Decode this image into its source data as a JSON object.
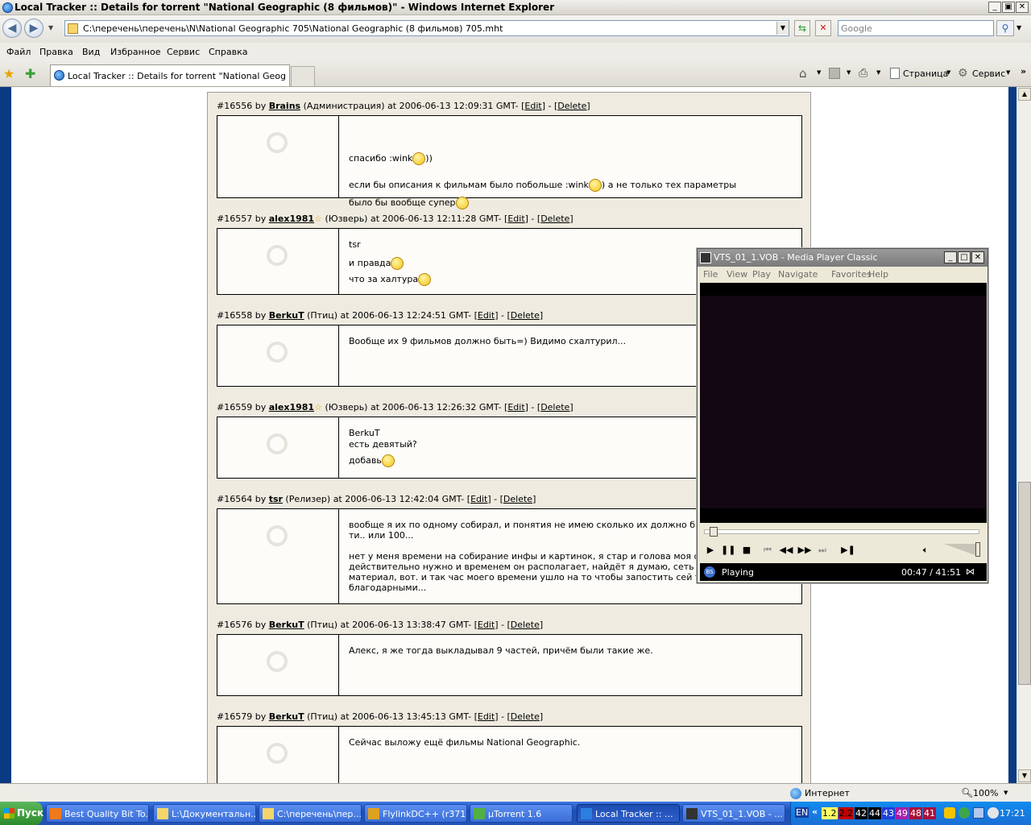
{
  "window": {
    "title": "Local Tracker :: Details for torrent \"National Geographic (8 фильмов)\" - Windows Internet Explorer"
  },
  "nav": {
    "address": "C:\\перечень\\перечень\\N\\National Geographic 705\\National Geographic (8 фильмов) 705.mht",
    "search_placeholder": "Google"
  },
  "menu": {
    "items": [
      "Файл",
      "Правка",
      "Вид",
      "Избранное",
      "Сервис",
      "Справка"
    ]
  },
  "tabs": {
    "active": "Local Tracker :: Details for torrent \"National Geograph...",
    "page_btn": "Страница",
    "tools_btn": "Сервис"
  },
  "posts": [
    {
      "head_pre": "#16556 by ",
      "user": "Brains",
      "head_post": " (Администрация) at 2006-06-13 12:09:31 GMT- [",
      "edit": "Edit",
      "sep": "] - [",
      "del": "Delete",
      "end": "]",
      "lines": [
        "спасибо :wink",
        "))",
        "если бы описания к фильмам было побольше :wink",
        ") а не только тех параметры",
        "было бы вообще супер"
      ]
    },
    {
      "head_pre": "#16557 by ",
      "user": "alex1981",
      "head_post": " (Юзверь) at 2006-06-13 12:11:28 GMT- [",
      "edit": "Edit",
      "sep": "] - [",
      "del": "Delete",
      "end": "]",
      "lines": [
        "tsr",
        "и правда",
        "что за халтура"
      ]
    },
    {
      "head_pre": "#16558 by ",
      "user": "BerkuT",
      "head_post": " (Птиц) at 2006-06-13 12:24:51 GMT- [",
      "edit": "Edit",
      "sep": "] - [",
      "del": "Delete",
      "end": "]",
      "lines": [
        "Вообще их 9 фильмов должно быть=) Видимо схалтурил..."
      ]
    },
    {
      "head_pre": "#16559 by ",
      "user": "alex1981",
      "head_post": " (Юзверь) at 2006-06-13 12:26:32 GMT- [",
      "edit": "Edit",
      "sep": "] - [",
      "del": "Delete",
      "end": "]",
      "lines": [
        "BerkuT",
        "есть девятый?",
        "добавь"
      ]
    },
    {
      "head_pre": "#16564 by ",
      "user": "tsr",
      "head_post": " (Релизер) at 2006-06-13 12:42:04 GMT- [",
      "edit": "Edit",
      "sep": "] - [",
      "del": "Delete",
      "end": "]",
      "lines": [
        "вообще я их по одному собирал, и понятия не имею сколько их должно быть.. но ду",
        "ти.. или 100...",
        "нет у меня времени на собирание инфы и картинок, я стар и голова моя седа уж.. ес",
        "действительно нужно и временем он располагает, найдёт я думаю, сеть большая..",
        "материал, вот. и так час моего времени ушло на то чтобы запостить сей торрент, у",
        "благодарными..."
      ]
    },
    {
      "head_pre": "#16576 by ",
      "user": "BerkuT",
      "head_post": " (Птиц) at 2006-06-13 13:38:47 GMT- [",
      "edit": "Edit",
      "sep": "] - [",
      "del": "Delete",
      "end": "]",
      "lines": [
        "Алекс, я же тогда выкладывал 9 частей, причём были такие же."
      ]
    },
    {
      "head_pre": "#16579 by ",
      "user": "BerkuT",
      "head_post": " (Птиц) at 2006-06-13 13:45:13 GMT- [",
      "edit": "Edit",
      "sep": "] - [",
      "del": "Delete",
      "end": "]",
      "lines": [
        "Сейчас выложу ещё фильмы National Geographic."
      ]
    }
  ],
  "status": {
    "zone": "Интернет",
    "zoom": "100%"
  },
  "taskbar": {
    "start": "Пуск",
    "tasks": [
      "Best Quality Bit To...",
      "L:\\Документальн...",
      "C:\\перечень\\пер...",
      "FlylinkDC++ (r371...",
      "µTorrent 1.6",
      "Local Tracker :: ...",
      "VTS_01_1.VOB - ..."
    ],
    "lang": "EN",
    "tray_nums": [
      "1.2",
      "2.2",
      "42",
      "44",
      "43",
      "49",
      "48",
      "41"
    ],
    "tray_colors": [
      "#ffff66",
      "#c00000",
      "#000000",
      "#000000",
      "#1e3fd9",
      "#a81ea8",
      "#a8103a",
      "#a8103a"
    ],
    "tray_text_colors": [
      "#000",
      "#000",
      "#fff",
      "#fff",
      "#fff",
      "#fff",
      "#fff",
      "#fff"
    ],
    "clock": "17:21"
  },
  "mpc": {
    "title": "VTS_01_1.VOB - Media Player Classic",
    "menu": [
      "File",
      "View",
      "Play",
      "Navigate",
      "Favorites",
      "Help"
    ],
    "status": "Playing",
    "time": "00:47 / 41:51",
    "progress": 0.019
  }
}
